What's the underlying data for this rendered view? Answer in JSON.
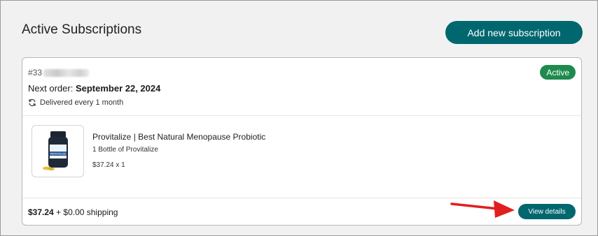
{
  "page": {
    "title": "Active Subscriptions",
    "add_button_label": "Add new subscription"
  },
  "subscription": {
    "id_prefix": "#33",
    "status": "Active",
    "next_order_label": "Next order:",
    "next_order_date": "September 22, 2024",
    "delivery_text": "Delivered every 1 month",
    "product": {
      "name": "Provitalize | Best Natural Menopause Probiotic",
      "variant": "1 Bottle of Provitalize",
      "price_line": "$37.24 x 1",
      "bottle_label": "PROVITALIZE"
    },
    "total_amount": "$37.24",
    "shipping_text": "+ $0.00 shipping",
    "view_button_label": "View details"
  },
  "colors": {
    "accent": "#00676f",
    "status_active": "#1e8a4e",
    "annotation_arrow": "#e02020"
  },
  "icons": {
    "delivery": "refresh-icon"
  }
}
